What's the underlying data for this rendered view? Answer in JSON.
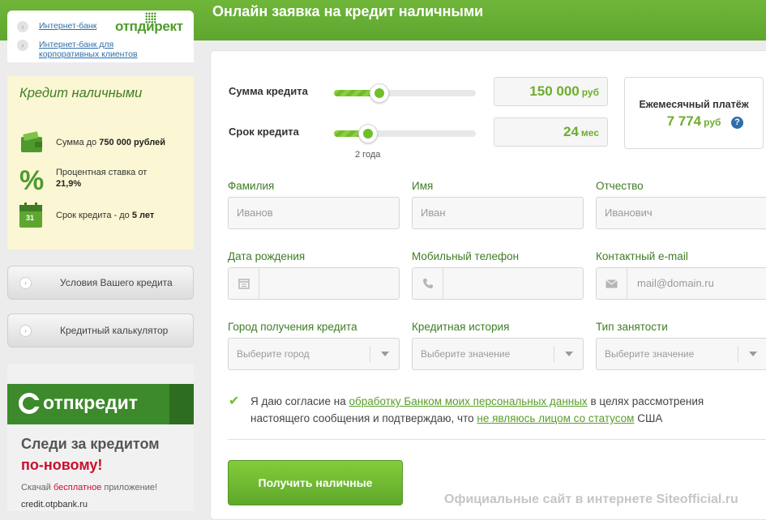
{
  "header": {
    "title": "Онлайн заявка на кредит наличными"
  },
  "top_links": {
    "logo": "отпдирект",
    "items": [
      {
        "label": "Интернет-банк"
      },
      {
        "label": "Интернет-банк для корпоративных клиентов"
      }
    ]
  },
  "promo": {
    "title": "Кредит наличными",
    "items": [
      {
        "text": "Сумма до",
        "bold": "750 000 рублей",
        "icon": "wallet-icon"
      },
      {
        "text": "Процентная ставка от",
        "bold": "21,9%",
        "icon": "percent-icon"
      },
      {
        "text": "Срок кредита - до",
        "bold": "5 лет",
        "icon": "calendar-icon",
        "icon_text": "31"
      }
    ]
  },
  "side_buttons": [
    {
      "label": "Условия Вашего кредита"
    },
    {
      "label": "Кредитный калькулятор"
    }
  ],
  "ad": {
    "logo": "отпкредит",
    "line1": "Следи за кредитом",
    "line2": "по-новому!",
    "text_before": "Скачай",
    "text_highlight": "бесплатное",
    "text_after": "приложение!",
    "url": "credit.otpbank.ru"
  },
  "calculator": {
    "amount": {
      "label": "Сумма кредита",
      "value": "150 000",
      "unit": "руб",
      "slider_fraction": 0.32
    },
    "term": {
      "label": "Срок кредита",
      "value": "24",
      "unit": "мес",
      "slider_fraction": 0.24,
      "note": "2 года"
    },
    "monthly": {
      "label": "Ежемесячный платёж",
      "value": "7 774",
      "unit": "руб",
      "help": "?"
    }
  },
  "form": {
    "last_name": {
      "label": "Фамилия",
      "placeholder": "Иванов"
    },
    "first_name": {
      "label": "Имя",
      "placeholder": "Иван"
    },
    "patronymic": {
      "label": "Отчество",
      "placeholder": "Иванович"
    },
    "birth_date": {
      "label": "Дата рождения",
      "placeholder": ""
    },
    "phone": {
      "label": "Мобильный телефон",
      "placeholder": ""
    },
    "email": {
      "label": "Контактный e-mail",
      "placeholder": "mail@domain.ru"
    },
    "city": {
      "label": "Город получения кредита",
      "placeholder": "Выберите город"
    },
    "credit_history": {
      "label": "Кредитная история",
      "placeholder": "Выберите значение"
    },
    "employment": {
      "label": "Тип занятости",
      "placeholder": "Выберите значение"
    }
  },
  "consent": {
    "checked": true,
    "part1": "Я даю согласие на",
    "link1": "обработку Банком моих персональных данных",
    "part2": "в целях рассмотрения настоящего сообщения и подтверждаю, что",
    "link2": "не являюсь лицом со статусом",
    "part3": "США"
  },
  "submit": {
    "label": "Получить наличные"
  },
  "watermark": "Официальные сайт в интернете Siteofficial.ru",
  "colors": {
    "brand_green": "#5ea62f",
    "accent_green": "#6cae2c",
    "link_blue": "#2f6ea8"
  }
}
